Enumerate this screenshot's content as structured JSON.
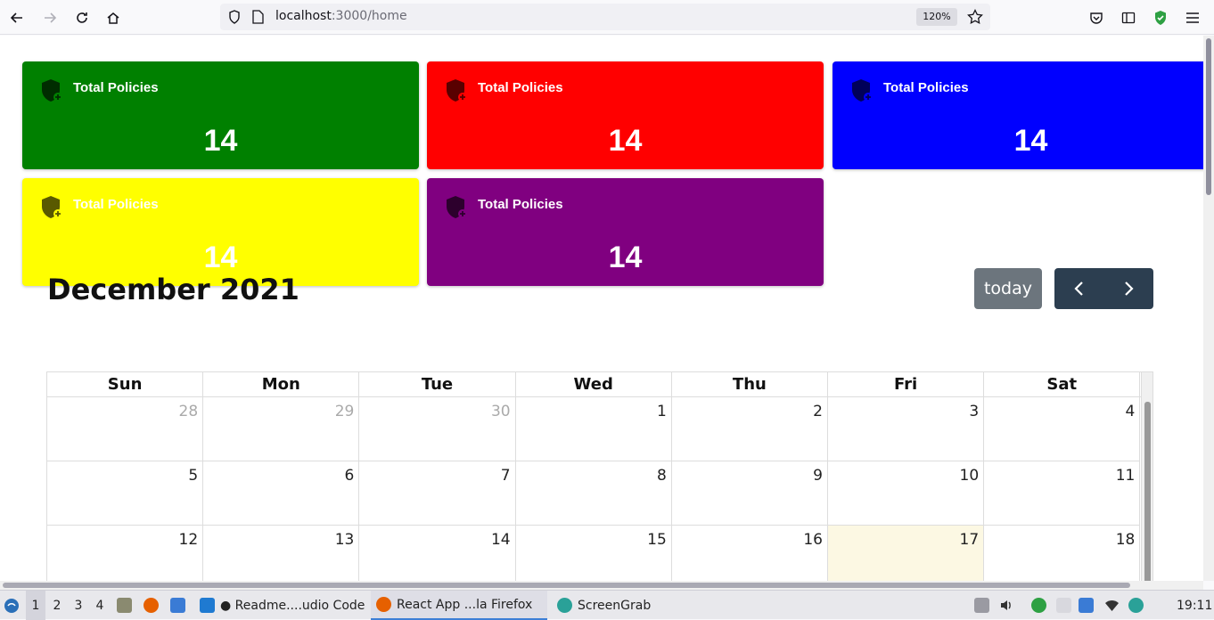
{
  "browser": {
    "url_host": "localhost",
    "url_path": ":3000/home",
    "zoom": "120%"
  },
  "cards": [
    {
      "title": "Total Policies",
      "value": "14",
      "color": "#008000",
      "icon": "shield-plus-icon"
    },
    {
      "title": "Total Policies",
      "value": "14",
      "color": "#ff0000",
      "icon": "shield-plus-icon"
    },
    {
      "title": "Total Policies",
      "value": "14",
      "color": "#0000ff",
      "icon": "shield-plus-icon"
    },
    {
      "title": "Total Policies",
      "value": "14",
      "color": "#ffff00",
      "icon": "shield-plus-icon"
    },
    {
      "title": "Total Policies",
      "value": "14",
      "color": "#800080",
      "icon": "shield-plus-icon"
    }
  ],
  "calendar": {
    "title": "December 2021",
    "today_label": "today",
    "weekdays": [
      "Sun",
      "Mon",
      "Tue",
      "Wed",
      "Thu",
      "Fri",
      "Sat"
    ],
    "weeks": [
      [
        {
          "d": "28",
          "other": true
        },
        {
          "d": "29",
          "other": true
        },
        {
          "d": "30",
          "other": true
        },
        {
          "d": "1"
        },
        {
          "d": "2"
        },
        {
          "d": "3"
        },
        {
          "d": "4"
        }
      ],
      [
        {
          "d": "5"
        },
        {
          "d": "6"
        },
        {
          "d": "7"
        },
        {
          "d": "8"
        },
        {
          "d": "9"
        },
        {
          "d": "10"
        },
        {
          "d": "11"
        }
      ],
      [
        {
          "d": "12"
        },
        {
          "d": "13"
        },
        {
          "d": "14"
        },
        {
          "d": "15"
        },
        {
          "d": "16"
        },
        {
          "d": "17",
          "today": true
        },
        {
          "d": "18"
        }
      ]
    ]
  },
  "taskbar": {
    "workspaces": [
      "1",
      "2",
      "3",
      "4"
    ],
    "tasks": [
      {
        "label": "● Readme....udio Code",
        "icon": "vscode-icon"
      },
      {
        "label": "React App ...la Firefox",
        "icon": "firefox-icon"
      },
      {
        "label": "ScreenGrab",
        "icon": "screengrab-icon"
      }
    ],
    "clock": "19:11"
  }
}
